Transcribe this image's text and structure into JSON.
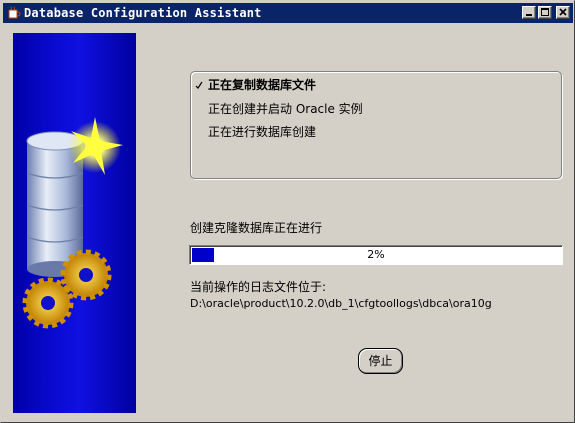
{
  "window": {
    "title": "Database Configuration Assistant",
    "titlebar_color": "#0a246a"
  },
  "steps": [
    {
      "label": "正在复制数据库文件",
      "state": "in-progress"
    },
    {
      "label": "正在创建并启动 Oracle 实例",
      "state": "pending"
    },
    {
      "label": "正在进行数据库创建",
      "state": "pending"
    }
  ],
  "progress": {
    "label": "创建克隆数据库正在进行",
    "percent_text": "2%",
    "fraction": 0.02,
    "fill_color": "#0000c8"
  },
  "log": {
    "label": "当前操作的日志文件位于:",
    "path": "D:\\oracle\\product\\10.2.0\\db_1\\cfgtoollogs\\dbca\\ora10g"
  },
  "buttons": {
    "stop": "停止"
  },
  "icons": {
    "title": "java-cup-icon",
    "side_image": "database-cylinder-gears-illustration"
  }
}
